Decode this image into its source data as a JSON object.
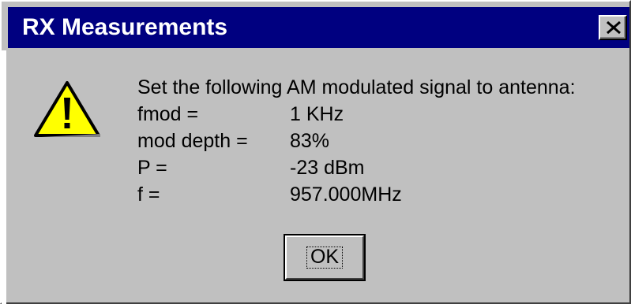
{
  "window": {
    "title": "RX Measurements",
    "title_bar_color": "#000080",
    "background_color": "#c0c0c0"
  },
  "icon": "warning-icon",
  "message": {
    "intro": "Set the following AM modulated signal to antenna:",
    "rows": [
      {
        "label": "fmod =",
        "value": "1 KHz"
      },
      {
        "label": "mod depth =",
        "value": "83%"
      },
      {
        "label": "P =",
        "value": "-23 dBm"
      },
      {
        "label": "f =",
        "value": "957.000MHz"
      }
    ]
  },
  "buttons": {
    "ok_label": "OK"
  }
}
